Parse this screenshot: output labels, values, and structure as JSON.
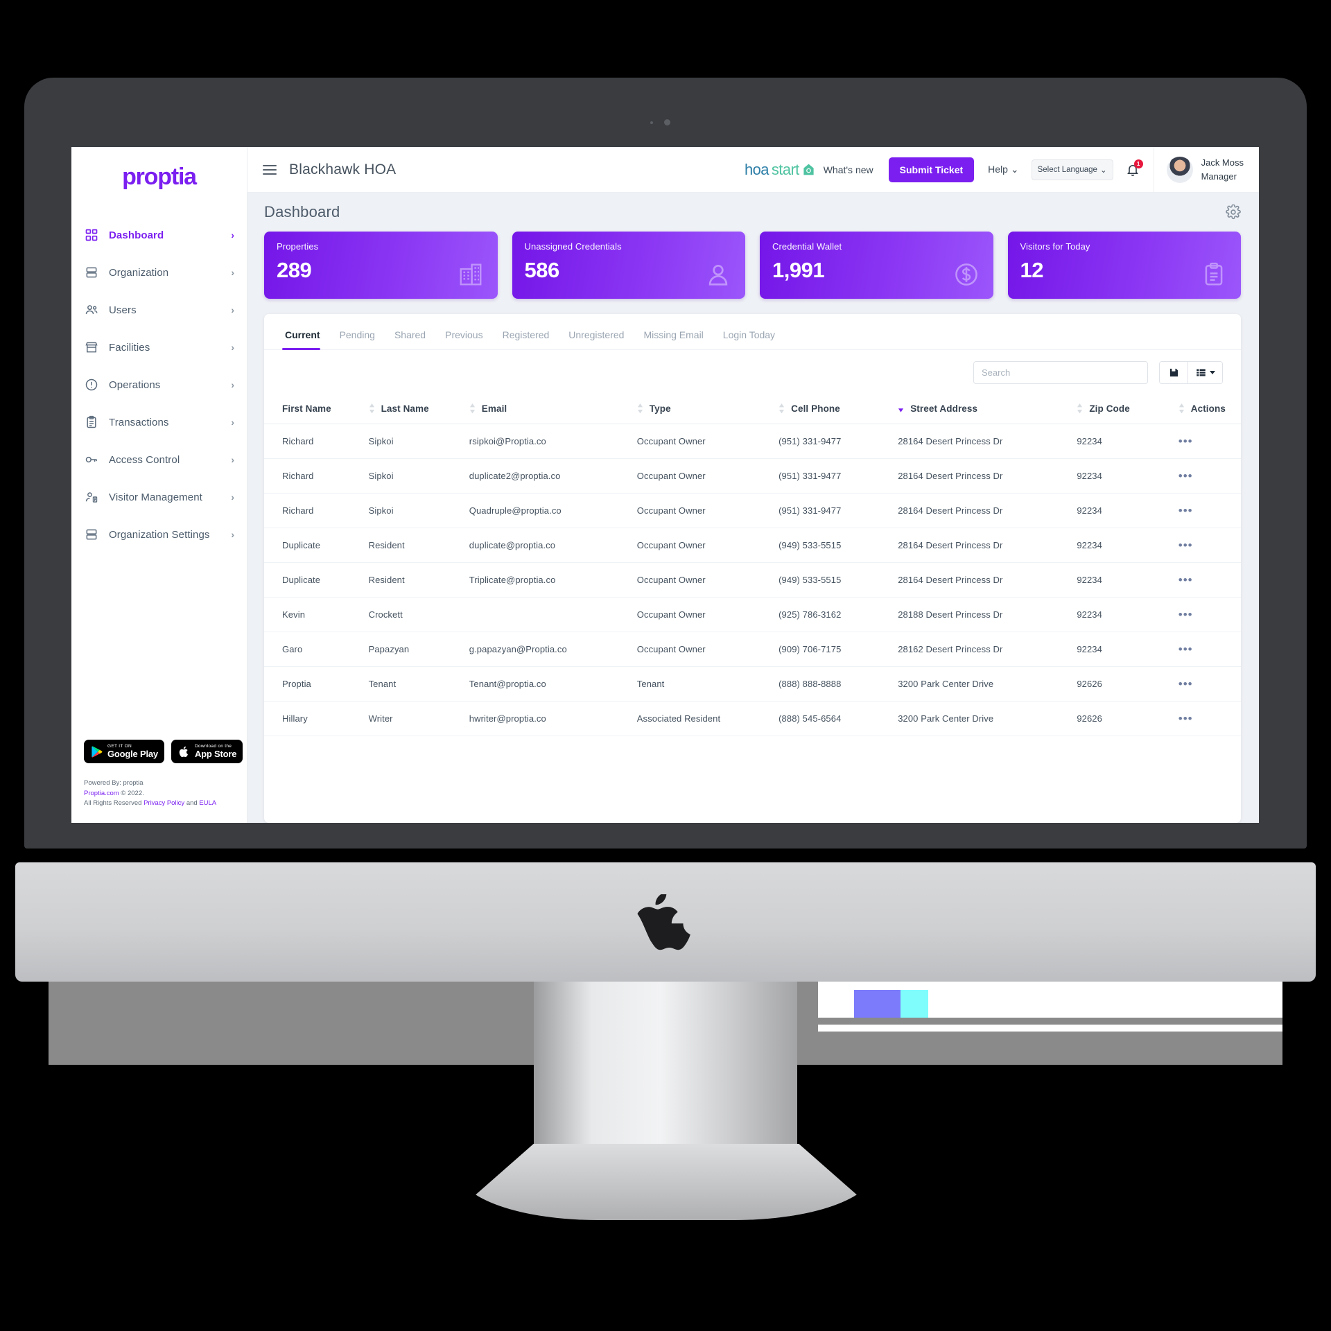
{
  "sidebar": {
    "brand": "proptia",
    "items": [
      {
        "label": "Dashboard",
        "icon": "grid-icon",
        "chevron": "›",
        "active": true
      },
      {
        "label": "Organization",
        "icon": "building-stack-icon",
        "chevron": "›",
        "active": false
      },
      {
        "label": "Users",
        "icon": "users-icon",
        "chevron": "›",
        "active": false
      },
      {
        "label": "Facilities",
        "icon": "storefront-icon",
        "chevron": "›",
        "active": false
      },
      {
        "label": "Operations",
        "icon": "alert-circle-icon",
        "chevron": "›",
        "active": false
      },
      {
        "label": "Transactions",
        "icon": "clipboard-icon",
        "chevron": "›",
        "active": false
      },
      {
        "label": "Access Control",
        "icon": "key-icon",
        "chevron": "›",
        "active": false
      },
      {
        "label": "Visitor Management",
        "icon": "visitor-badge-icon",
        "chevron": "›",
        "active": false
      },
      {
        "label": "Organization Settings",
        "icon": "building-stack-icon",
        "chevron": "›",
        "active": false
      }
    ],
    "badges": [
      {
        "icon": "google-play-icon",
        "small": "GET IT ON",
        "big": "Google Play"
      },
      {
        "icon": "apple-icon",
        "small": "Download on the",
        "big": "App Store"
      }
    ],
    "footer": {
      "powered_by": "Powered By: proptia",
      "copyright_link": "Proptia.com",
      "copyright_rest": " © 2022.",
      "rights": "All Rights Reserved ",
      "privacy": "Privacy Policy",
      "and": " and ",
      "eula": "EULA"
    }
  },
  "topbar": {
    "menu_icon": "hamburger-icon",
    "org_title": "Blackhawk HOA",
    "hoastart_a": "hoa",
    "hoastart_b": "start",
    "whats_new": "What's new",
    "submit_ticket": "Submit Ticket",
    "help": "Help",
    "help_caret": "⌄",
    "language": "Select Language",
    "language_caret": "⌄",
    "notification_count": "1",
    "user_name": "Jack Moss",
    "user_role": "Manager"
  },
  "page": {
    "title": "Dashboard",
    "settings_icon": "gear-icon"
  },
  "kpis": [
    {
      "label": "Properties",
      "value": "289",
      "icon": "building-icon"
    },
    {
      "label": "Unassigned Credentials",
      "value": "586",
      "icon": "person-icon"
    },
    {
      "label": "Credential Wallet",
      "value": "1,991",
      "icon": "dollar-circle-icon"
    },
    {
      "label": "Visitors for Today",
      "value": "12",
      "icon": "clipboard-list-icon"
    }
  ],
  "tabs": [
    {
      "label": "Current",
      "active": true
    },
    {
      "label": "Pending",
      "active": false
    },
    {
      "label": "Shared",
      "active": false
    },
    {
      "label": "Previous",
      "active": false
    },
    {
      "label": "Registered",
      "active": false
    },
    {
      "label": "Unregistered",
      "active": false
    },
    {
      "label": "Missing Email",
      "active": false
    },
    {
      "label": "Login Today",
      "active": false
    }
  ],
  "toolbar": {
    "search_placeholder": "Search",
    "search_value": "",
    "save_icon": "save-icon",
    "columns_icon": "list-view-icon"
  },
  "table": {
    "columns": [
      {
        "label": "First Name",
        "sortable": true,
        "sort": "none",
        "cls": "c-first"
      },
      {
        "label": "Last Name",
        "sortable": true,
        "sort": "none",
        "cls": "c-last"
      },
      {
        "label": "Email",
        "sortable": true,
        "sort": "none",
        "cls": "c-email"
      },
      {
        "label": "Type",
        "sortable": true,
        "sort": "none",
        "cls": "c-type"
      },
      {
        "label": "Cell Phone",
        "sortable": true,
        "sort": "desc",
        "cls": "c-phone"
      },
      {
        "label": "Street Address",
        "sortable": true,
        "sort": "none",
        "cls": "c-addr"
      },
      {
        "label": "Zip Code",
        "sortable": true,
        "sort": "none",
        "cls": "c-zip"
      },
      {
        "label": "Actions",
        "sortable": false,
        "sort": "none",
        "cls": "c-act"
      }
    ],
    "rows": [
      {
        "first": "Richard",
        "last": "Sipkoi",
        "email": "rsipkoi@Proptia.co",
        "type": "Occupant Owner",
        "phone": "(951) 331-9477",
        "address": "28164 Desert Princess Dr",
        "zip": "92234",
        "actions": "•••"
      },
      {
        "first": "Richard",
        "last": "Sipkoi",
        "email": "duplicate2@proptia.co",
        "type": "Occupant Owner",
        "phone": "(951) 331-9477",
        "address": "28164 Desert Princess Dr",
        "zip": "92234",
        "actions": "•••"
      },
      {
        "first": "Richard",
        "last": "Sipkoi",
        "email": "Quadruple@proptia.co",
        "type": "Occupant Owner",
        "phone": "(951) 331-9477",
        "address": "28164 Desert Princess Dr",
        "zip": "92234",
        "actions": "•••"
      },
      {
        "first": "Duplicate",
        "last": "Resident",
        "email": "duplicate@proptia.co",
        "type": "Occupant Owner",
        "phone": "(949) 533-5515",
        "address": "28164 Desert Princess Dr",
        "zip": "92234",
        "actions": "•••"
      },
      {
        "first": "Duplicate",
        "last": "Resident",
        "email": "Triplicate@proptia.co",
        "type": "Occupant Owner",
        "phone": "(949) 533-5515",
        "address": "28164 Desert Princess Dr",
        "zip": "92234",
        "actions": "•••"
      },
      {
        "first": "Kevin",
        "last": "Crockett",
        "email": "",
        "type": "Occupant Owner",
        "phone": "(925) 786-3162",
        "address": "28188 Desert Princess Dr",
        "zip": "92234",
        "actions": "•••"
      },
      {
        "first": "Garo",
        "last": "Papazyan",
        "email": "g.papazyan@Proptia.co",
        "type": "Occupant Owner",
        "phone": "(909) 706-7175",
        "address": "28162 Desert Princess Dr",
        "zip": "92234",
        "actions": "•••"
      },
      {
        "first": "Proptia",
        "last": "Tenant",
        "email": "Tenant@proptia.co",
        "type": "Tenant",
        "phone": "(888) 888-8888",
        "address": "3200 Park Center Drive",
        "zip": "92626",
        "actions": "•••"
      },
      {
        "first": "Hillary",
        "last": "Writer",
        "email": "hwriter@proptia.co",
        "type": "Associated Resident",
        "phone": "(888) 545-6564",
        "address": "3200 Park Center Drive",
        "zip": "92626",
        "actions": "•••"
      }
    ]
  },
  "colors": {
    "brand_purple": "#7b1ff0",
    "kpi_gradient_start": "#7416e8",
    "kpi_gradient_end": "#9b56fb",
    "badge_red": "#e8173d",
    "page_bg": "#eef1f5"
  }
}
